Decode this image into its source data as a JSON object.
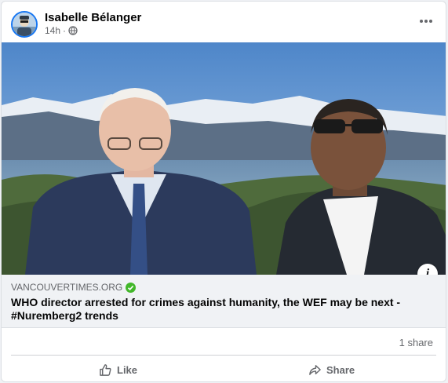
{
  "post": {
    "author": "Isabelle Bélanger",
    "time": "14h",
    "time_separator": "·",
    "privacy_icon": "globe-icon",
    "more_icon": "more-horizontal-icon"
  },
  "link_preview": {
    "domain": "VANCOUVERTIMES.ORG",
    "headline": "WHO director arrested for crimes against humanity, the WEF may be next - #Nuremberg2 trends",
    "info_icon_label": "i"
  },
  "engagement": {
    "shares": "1 share"
  },
  "actions": {
    "like_label": "Like",
    "share_label": "Share"
  },
  "colors": {
    "accent": "#1877f2",
    "verified": "#42b72a",
    "muted_text": "#65676b",
    "link_bg": "#f0f2f5"
  }
}
